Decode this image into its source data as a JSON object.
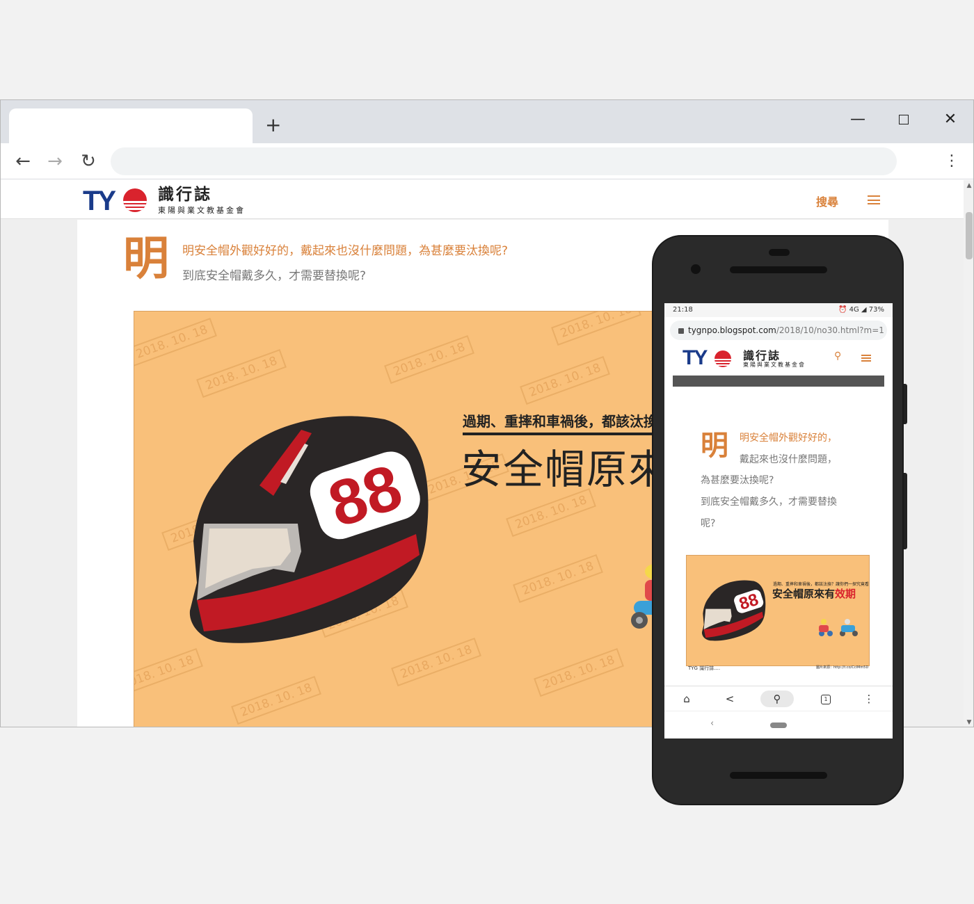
{
  "browser": {
    "new_tab": "+",
    "window_controls": {
      "minimize": "—",
      "close": "✕"
    },
    "nav": {
      "back": "←",
      "forward": "→",
      "reload": "↻",
      "menu": "⋮"
    }
  },
  "site": {
    "logo": {
      "mark": "TY",
      "name": "識行誌",
      "subtitle": "東陽與業文教基金會"
    },
    "search_label": "搜尋",
    "colors": {
      "accent": "#d9813a",
      "brand_blue": "#1a3b8a",
      "brand_red": "#d9232d",
      "hero_bg": "#f9c07a"
    }
  },
  "article": {
    "dropcap": "明",
    "lead_line1": "明安全帽外觀好好的，戴起來也沒什麼問題，為甚麼要汰換呢?",
    "lead_line2": "到底安全帽戴多久，才需要替換呢?",
    "hero": {
      "subtitle": "過期、重摔和車禍後，都該汰換",
      "title": "安全帽原來",
      "watermark": "2018. 10. 18",
      "helmet_number": "88"
    }
  },
  "phone": {
    "status_time": "21:18",
    "status_right": "⏰ 4G ◢ 73%",
    "url_host": "tygnpo.blogspot.com",
    "url_path": "/2018/10/no30.html?m=1",
    "logo": {
      "mark": "TY",
      "name": "識行誌",
      "subtitle": "東陽與業文教基金會"
    },
    "dropcap": "明",
    "lines": [
      "明安全帽外觀好好的，",
      "戴起來也沒什麼問題，",
      "為甚麼要汰換呢?",
      "到底安全帽戴多久，才需要替換",
      "呢?"
    ],
    "hero": {
      "subtitle": "過期、重摔和車禍後，都該汰換？讓你們一探究竟看看",
      "title_main": "安全帽原來有",
      "title_accent": "效期",
      "helmet_number": "88"
    },
    "caption_logo": "TYG 識行誌....",
    "caption_source": "圖片來源：http://t.co/CcIMm5D",
    "bottom_bar": {
      "home": "⌂",
      "share": "<",
      "search": "🔍",
      "tabs": "1",
      "more": "⋮"
    },
    "nav": {
      "back": "‹"
    }
  }
}
